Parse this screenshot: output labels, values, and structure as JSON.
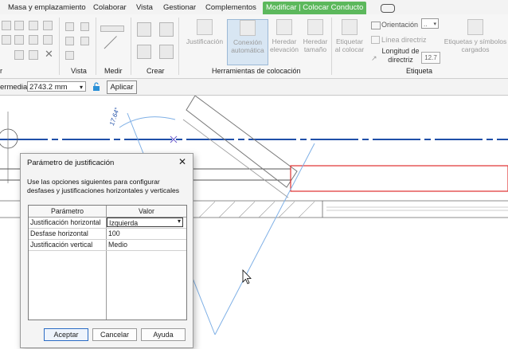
{
  "ribbon_tabs": [
    "Masa y emplazamiento",
    "Colaborar",
    "Vista",
    "Gestionar",
    "Complementos",
    "Modificar | Colocar Conducto"
  ],
  "ribbon": {
    "panels": {
      "partial": "r",
      "vista": "Vista",
      "medir": "Medir",
      "crear": "Crear",
      "herramientas": "Herramientas de colocación",
      "etiqueta": "Etiqueta"
    },
    "buttons": {
      "justificacion": [
        "Justificación"
      ],
      "conexion": [
        "Conexión",
        "automática"
      ],
      "heredar_elevacion": [
        "Heredar",
        "elevación"
      ],
      "heredar_tamano": [
        "Heredar",
        "tamaño"
      ],
      "etiquetar": [
        "Etiquetar",
        "al colocar"
      ],
      "orientacion": "Orientación",
      "orientacion_value": "..",
      "linea_directriz": "Línea directriz",
      "longitud": [
        "Longitud de",
        "directriz"
      ],
      "longitud_value": "12.7",
      "simbolos": [
        "Etiquetas y símbolos",
        "cargados"
      ]
    }
  },
  "options_bar": {
    "label": "ermedia:",
    "value": "2743.2 mm",
    "apply": "Aplicar"
  },
  "canvas": {
    "dim_text": "17.64°"
  },
  "dialog": {
    "title": "Parámetro de justificación",
    "description": "Use las opciones siguientes para configurar desfases y justificaciones horizontales y verticales",
    "columns": [
      "Parámetro",
      "Valor"
    ],
    "rows": [
      {
        "param": "Justificación horizontal",
        "value": "Izquierda"
      },
      {
        "param": "Desfase horizontal",
        "value": "100"
      },
      {
        "param": "Justificación vertical",
        "value": "Medio"
      }
    ],
    "buttons": {
      "ok": "Aceptar",
      "cancel": "Cancelar",
      "help": "Ayuda"
    }
  },
  "colors": {
    "active_tab": "#5cb85c",
    "duct_selected": "#e03030",
    "centerline": "#1f4fa8",
    "guide_line": "#7fb0e6"
  }
}
